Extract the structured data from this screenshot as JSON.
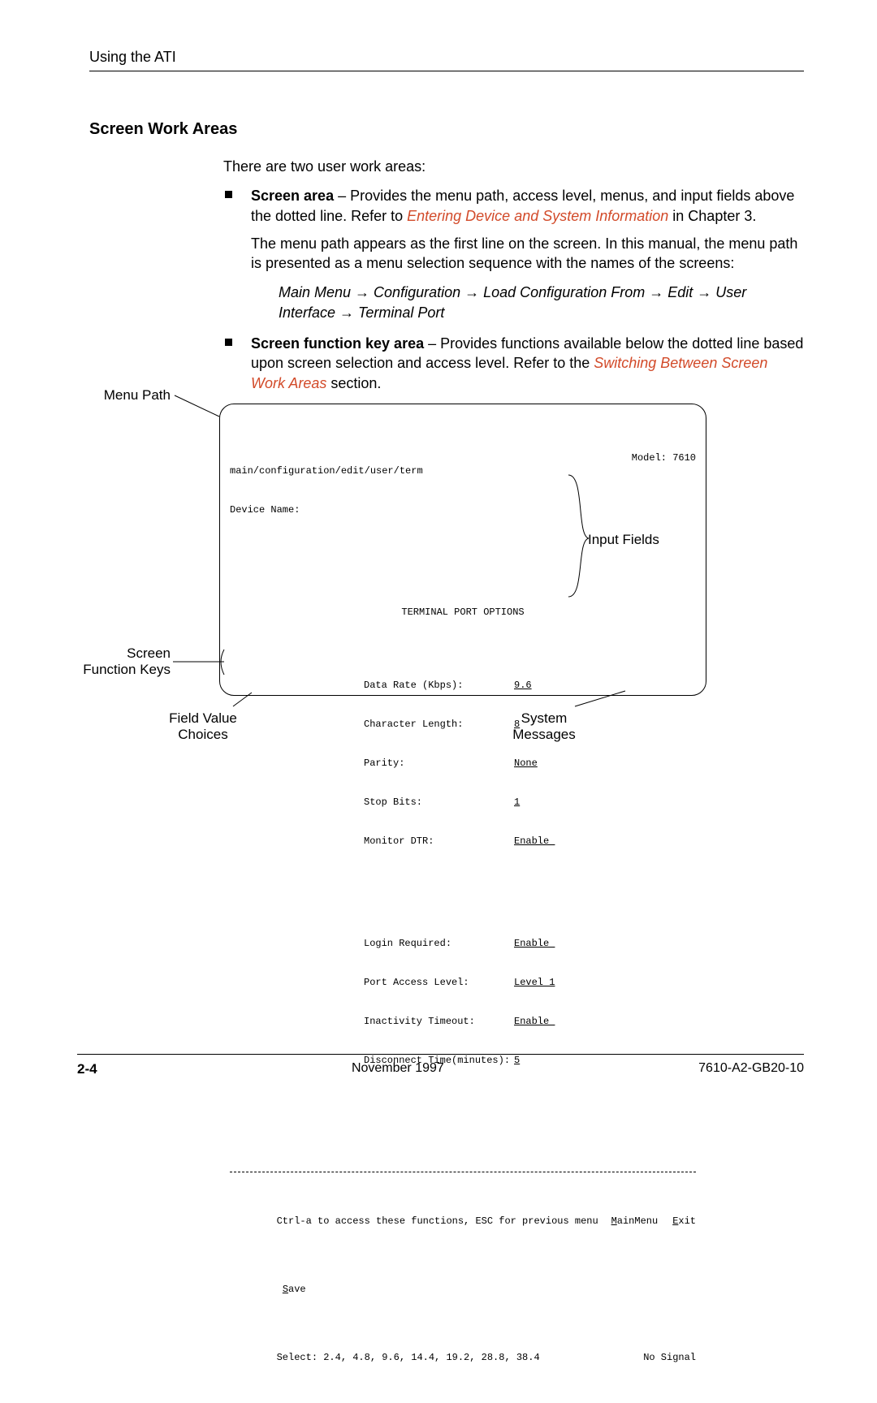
{
  "header": {
    "running_head": "Using the ATI"
  },
  "section": {
    "title": "Screen Work Areas"
  },
  "intro": "There are two user work areas:",
  "bullets": [
    {
      "lead_bold": "Screen area",
      "lead_rest": " – Provides the menu path, access level, menus, and input fields above the dotted line. Refer to ",
      "link_text": "Entering Device and System Information",
      "after_link": " in Chapter 3.",
      "para2": "The menu path appears as the first line on the screen. In this manual, the menu path is presented as a menu selection sequence with the names of the screens:",
      "menu_seq": "Main Menu → Configuration → Load Configuration From → Edit → User Interface → Terminal Port"
    },
    {
      "lead_bold": "Screen function key area",
      "lead_rest": " – Provides functions available below the dotted line based upon screen selection and access level. Refer to the ",
      "link_text": "Switching Between Screen Work Areas",
      "after_link": " section."
    }
  ],
  "callouts": {
    "menu_path": "Menu Path",
    "screen_fn_keys": "Screen Function Keys",
    "field_value_choices": "Field Value Choices",
    "system_messages": "System Messages",
    "input_fields": "Input Fields"
  },
  "terminal": {
    "path": "main/configuration/edit/user/term",
    "device_label": "Device Name:",
    "model_label": "Model:",
    "model_value": "7610",
    "title": "TERMINAL PORT OPTIONS",
    "fields_a": [
      {
        "label": "Data Rate (Kbps):",
        "value": "9.6"
      },
      {
        "label": "Character Length:",
        "value": "8"
      },
      {
        "label": "Parity:",
        "value": "None"
      },
      {
        "label": "Stop Bits:",
        "value": "1"
      },
      {
        "label": "Monitor DTR:",
        "value": "Enable "
      }
    ],
    "fields_b": [
      {
        "label": "Login Required:",
        "value": "Enable "
      },
      {
        "label": "Port Access Level:",
        "value": "Level 1"
      },
      {
        "label": "Inactivity Timeout:",
        "value": "Enable "
      },
      {
        "label": "Disconnect Time(minutes):",
        "value": "5"
      }
    ],
    "fn_hint": "Ctrl-a to access these functions, ESC for previous menu",
    "main_menu_u": "M",
    "main_menu_rest": "ainMenu",
    "exit_u": "E",
    "exit_rest": "xit",
    "save_u": "S",
    "save_rest": "ave",
    "select_line": "Select: 2.4, 4.8, 9.6, 14.4, 19.2, 28.8, 38.4",
    "no_signal": "No Signal"
  },
  "footer": {
    "page_num": "2-4",
    "date": "November 1997",
    "doc_id": "7610-A2-GB20-10"
  }
}
